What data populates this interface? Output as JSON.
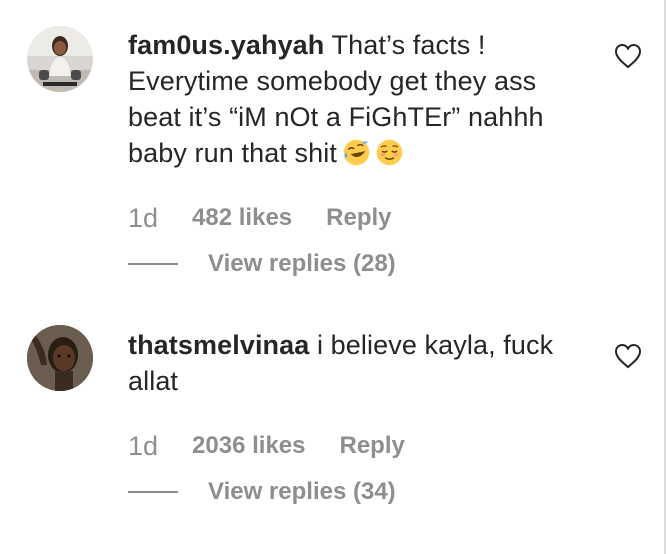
{
  "comments": [
    {
      "username": "fam0us.yahyah",
      "text": "That’s facts ! Everytime somebody get they ass beat it’s “iM nOt a FiGhTEr” nahhh baby run that shit",
      "emojis": [
        "rolling-on-floor-laughing-emoji",
        "relieved-face-emoji"
      ],
      "time": "1d",
      "likes": "482 likes",
      "reply_label": "Reply",
      "view_replies": "View replies (28)"
    },
    {
      "username": "thatsmelvinaa",
      "text": "i believe kayla, fuck allat",
      "emojis": [],
      "time": "1d",
      "likes": "2036 likes",
      "reply_label": "Reply",
      "view_replies": "View replies (34)"
    }
  ],
  "colors": {
    "text": "#262626",
    "muted": "#8e8e8e",
    "emoji_yellow": "#ffcc4d",
    "emoji_tears": "#5dadec"
  }
}
